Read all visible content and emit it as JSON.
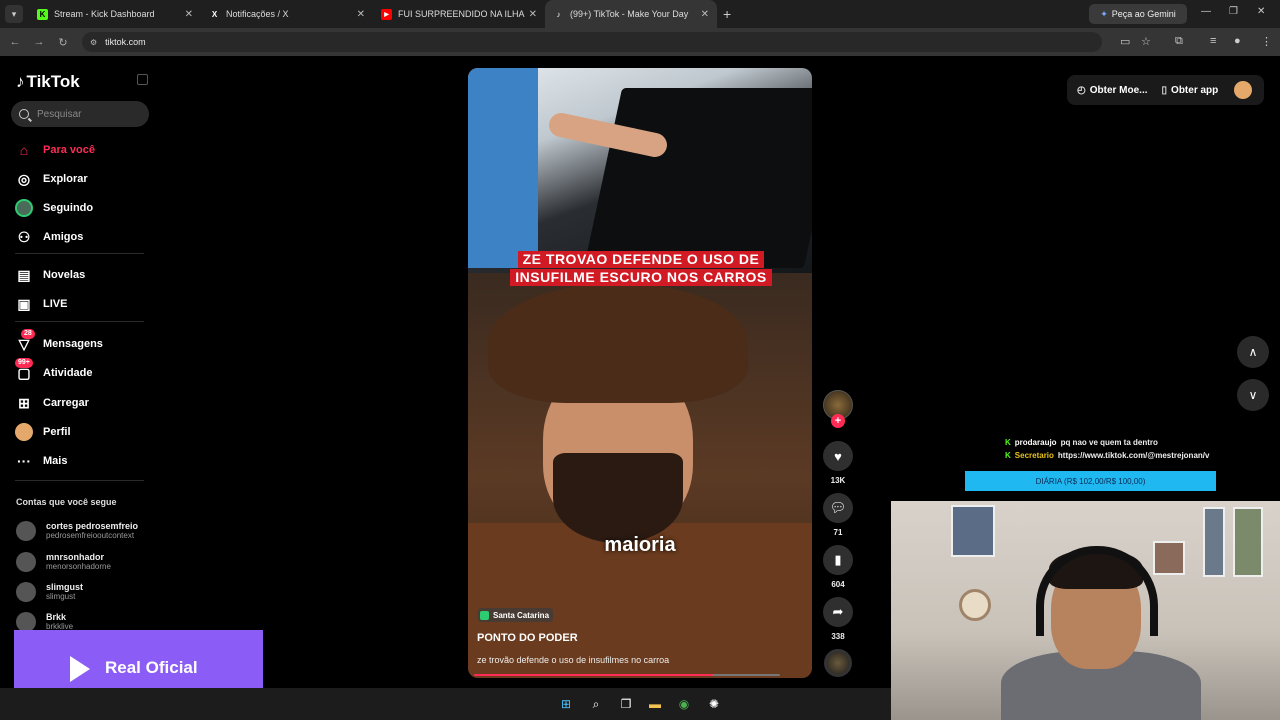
{
  "browser": {
    "tabs": [
      {
        "title": "Stream - Kick Dashboard",
        "icon": "kick-icon",
        "color": "#53fc18"
      },
      {
        "title": "Notificações / X",
        "icon": "x-icon",
        "color": "#ffffff"
      },
      {
        "title": "FUI SURPREENDIDO NA ILHA T",
        "icon": "youtube-icon",
        "color": "#ff0000"
      },
      {
        "title": "(99+) TikTok - Make Your Day",
        "icon": "tiktok-icon",
        "color": "#ffffff"
      }
    ],
    "gemini_label": "Peça ao Gemini",
    "url": "tiktok.com"
  },
  "sidebar": {
    "brand": "TikTok",
    "search_placeholder": "Pesquisar",
    "nav": [
      {
        "label": "Para você",
        "icon": "home-icon",
        "active": true
      },
      {
        "label": "Explorar",
        "icon": "compass-icon"
      },
      {
        "label": "Seguindo",
        "icon": "following-avatar-icon"
      },
      {
        "label": "Amigos",
        "icon": "friends-icon"
      },
      {
        "label": "Novelas",
        "icon": "film-icon"
      },
      {
        "label": "LIVE",
        "icon": "live-icon"
      },
      {
        "label": "Mensagens",
        "icon": "inbox-icon",
        "badge": "28"
      },
      {
        "label": "Atividade",
        "icon": "activity-icon",
        "badge": "99+"
      },
      {
        "label": "Carregar",
        "icon": "upload-icon"
      },
      {
        "label": "Perfil",
        "icon": "profile-avatar-icon"
      },
      {
        "label": "Mais",
        "icon": "more-icon"
      }
    ],
    "following_header": "Contas que você segue",
    "accounts": [
      {
        "name": "cortes pedrosemfreio",
        "handle": "pedrosemfreiooutcontext"
      },
      {
        "name": "mnrsonhador",
        "handle": "menorsonhadorne"
      },
      {
        "name": "slimgust",
        "handle": "slimgust"
      },
      {
        "name": "Brkk",
        "handle": "brkklive"
      }
    ]
  },
  "overlay_banner": "Real Oficial",
  "video": {
    "headline_line1": "ZE TROVAO DEFENDE O USO DE",
    "headline_line2": "INSUFILME ESCURO NOS CARROS",
    "subtitle": "maioria",
    "location": "Santa Catarina",
    "author": "PONTO DO PODER",
    "description": "ze trovão defende o uso de insufilmes no carroa",
    "progress": 0.78
  },
  "actions": {
    "likes": "13K",
    "comments": "71",
    "saves": "604",
    "shares": "338"
  },
  "topright": {
    "coins": "Obter Moe...",
    "app": "Obter app"
  },
  "stream_chat": [
    {
      "user": "prodaraujo",
      "message": "pq nao ve quem ta dentro"
    },
    {
      "user": "Secretario",
      "message": "https://www.tiktok.com/@mestrejonan/vi"
    }
  ],
  "stream_bar": "DIÁRIA (R$ 102,00/R$ 100,00)"
}
